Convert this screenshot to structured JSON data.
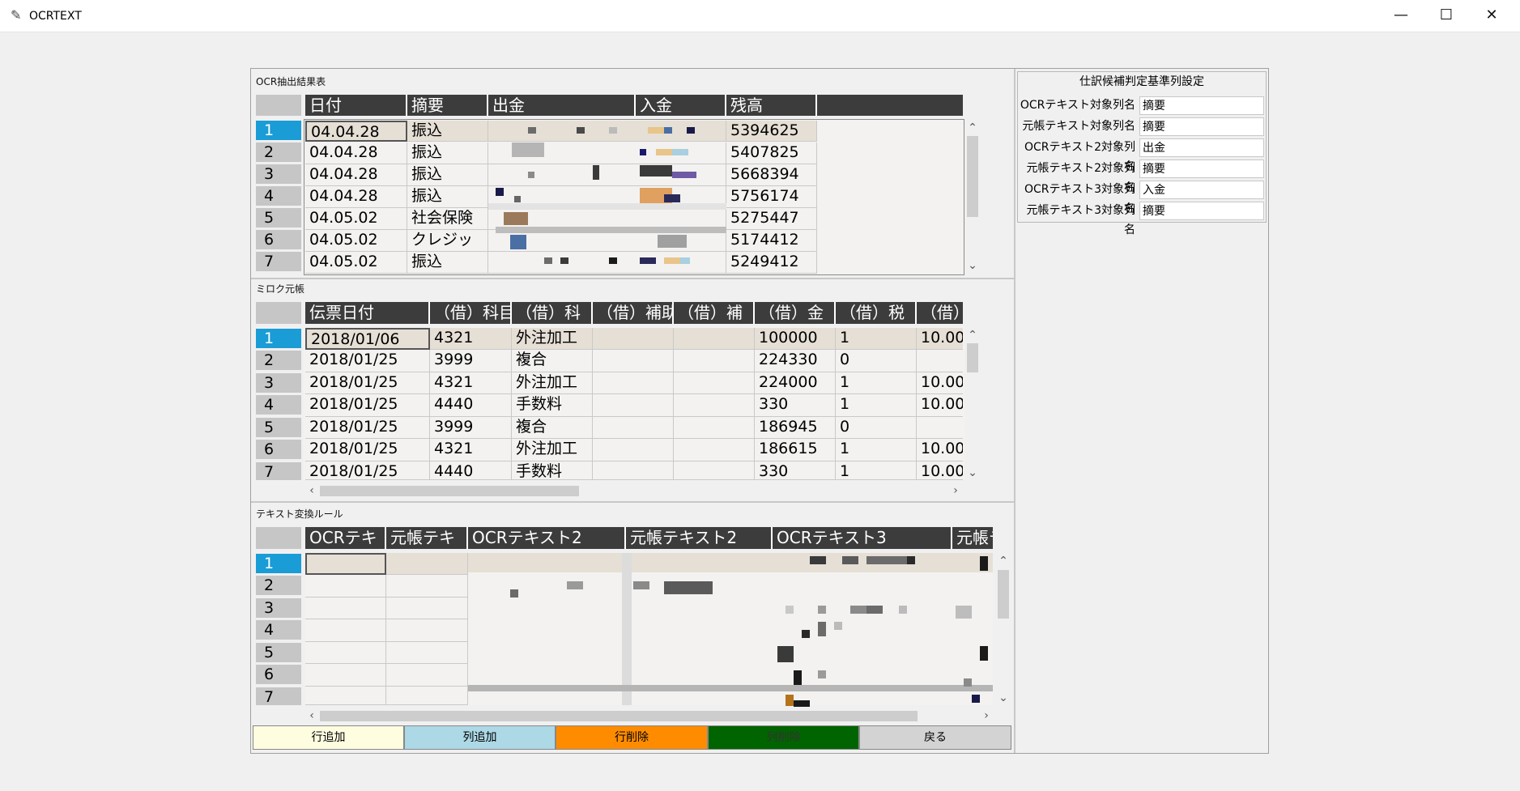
{
  "window": {
    "title": "OCRTEXT",
    "minimize": "—",
    "maximize": "☐",
    "close": "✕"
  },
  "ocr_table": {
    "label": "OCR抽出結果表",
    "columns": [
      "日付",
      "摘要",
      "出金",
      "入金",
      "残高",
      ""
    ],
    "row_numbers": [
      "1",
      "2",
      "3",
      "4",
      "5",
      "6",
      "7"
    ],
    "rows": [
      [
        "04.04.28",
        "振込",
        "",
        "",
        "5394625"
      ],
      [
        "04.04.28",
        "振込",
        "",
        "",
        "5407825"
      ],
      [
        "04.04.28",
        "振込",
        "",
        "",
        "5668394"
      ],
      [
        "04.04.28",
        "振込",
        "",
        "",
        "5756174"
      ],
      [
        "04.05.02",
        "社会保険",
        "",
        "",
        "5275447"
      ],
      [
        "04.05.02",
        "クレジッ",
        "",
        "",
        "5174412"
      ],
      [
        "04.05.02",
        "振込",
        "",
        "",
        "5249412"
      ]
    ]
  },
  "ledger_table": {
    "label": "ミロク元帳",
    "columns": [
      "伝票日付",
      "（借）科目",
      "（借）科",
      "（借）補助",
      "（借）補",
      "（借）金",
      "（借）税",
      "（借）"
    ],
    "row_numbers": [
      "1",
      "2",
      "3",
      "4",
      "5",
      "6",
      "7"
    ],
    "rows": [
      [
        "2018/01/06",
        "4321",
        "外注加工",
        "",
        "",
        "100000",
        "1",
        "10.00"
      ],
      [
        "2018/01/25",
        "3999",
        "複合",
        "",
        "",
        "224330",
        "0",
        ""
      ],
      [
        "2018/01/25",
        "4321",
        "外注加工",
        "",
        "",
        "224000",
        "1",
        "10.00"
      ],
      [
        "2018/01/25",
        "4440",
        "手数料",
        "",
        "",
        "330",
        "1",
        "10.00"
      ],
      [
        "2018/01/25",
        "3999",
        "複合",
        "",
        "",
        "186945",
        "0",
        ""
      ],
      [
        "2018/01/25",
        "4321",
        "外注加工",
        "",
        "",
        "186615",
        "1",
        "10.00"
      ],
      [
        "2018/01/25",
        "4440",
        "手数料",
        "",
        "",
        "330",
        "1",
        "10.00"
      ]
    ]
  },
  "rule_table": {
    "label": "テキスト変換ルール",
    "columns": [
      "OCRテキ",
      "元帳テキ",
      "OCRテキスト2",
      "元帳テキスト2",
      "OCRテキスト3",
      "元帳テ"
    ],
    "row_numbers": [
      "1",
      "2",
      "3",
      "4",
      "5",
      "6",
      "7"
    ]
  },
  "criteria_panel": {
    "title": "仕訳候補判定基準列設定",
    "items": [
      {
        "label": "OCRテキスト対象列名",
        "value": "摘要"
      },
      {
        "label": "元帳テキスト対象列名",
        "value": "摘要"
      },
      {
        "label": "OCRテキスト2対象列名",
        "value": "出金"
      },
      {
        "label": "元帳テキスト2対象列名",
        "value": "摘要"
      },
      {
        "label": "OCRテキスト3対象列名",
        "value": "入金"
      },
      {
        "label": "元帳テキスト3対象列名",
        "value": "摘要"
      }
    ]
  },
  "buttons": {
    "add_row": "行追加",
    "add_col": "列追加",
    "delete_row": "行削除",
    "delete_col": "列削除",
    "back": "戻る"
  },
  "colors": {
    "add_row_bg": "#fffde0",
    "add_col_bg": "#add8e6",
    "delete_row_bg": "#ff8c00",
    "delete_col_bg": "#006400",
    "back_bg": "#d3d3d3",
    "selected_row_header": "#1a9cd6",
    "header_bg": "#3c3c3c"
  }
}
